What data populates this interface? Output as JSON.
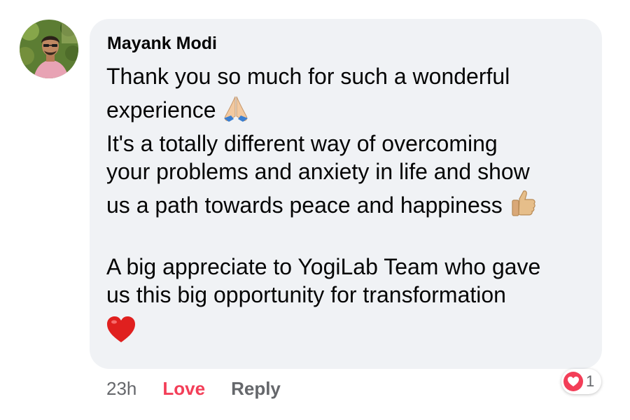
{
  "comment": {
    "author": "Mayank Modi",
    "lines": [
      "Thank you so much for such a wonderful",
      "experience",
      "It's a totally different way of overcoming",
      "your problems and anxiety in life and show",
      "us a path towards peace and happiness",
      "A big appreciate to YogiLab Team who gave",
      "us this big opportunity for transformation"
    ],
    "emojis": {
      "line2": "folded-hands",
      "line5": "thumbs-up",
      "final": "red-heart"
    }
  },
  "reaction": {
    "type": "love",
    "count": "1",
    "color": "#f33e58"
  },
  "actions": {
    "time": "23h",
    "love_label": "Love",
    "reply_label": "Reply"
  },
  "colors": {
    "bubble": "#f0f2f5",
    "text": "#050505",
    "secondary": "#65676b",
    "love": "#f33e58"
  }
}
